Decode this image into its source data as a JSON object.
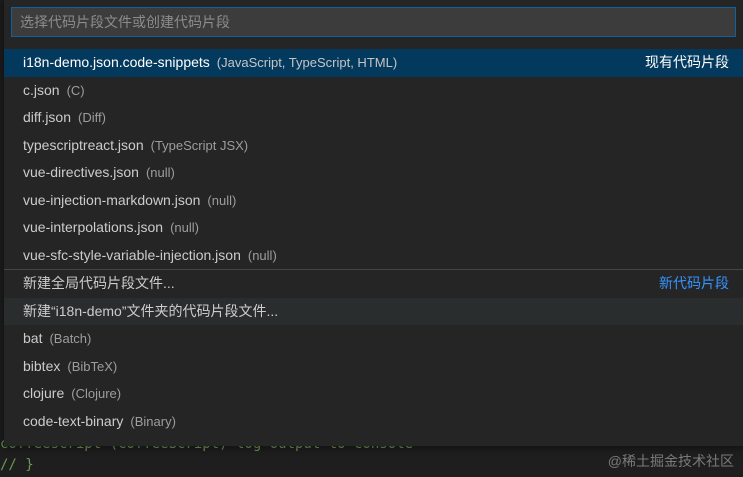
{
  "search": {
    "placeholder": "选择代码片段文件或创建代码片段"
  },
  "existing_snippets": {
    "group_label": "现有代码片段",
    "items": [
      {
        "name": "i18n-demo.json.code-snippets",
        "desc": "(JavaScript, TypeScript, HTML)"
      },
      {
        "name": "c.json",
        "desc": "(C)"
      },
      {
        "name": "diff.json",
        "desc": "(Diff)"
      },
      {
        "name": "typescriptreact.json",
        "desc": "(TypeScript JSX)"
      },
      {
        "name": "vue-directives.json",
        "desc": "(null)"
      },
      {
        "name": "vue-injection-markdown.json",
        "desc": "(null)"
      },
      {
        "name": "vue-interpolations.json",
        "desc": "(null)"
      },
      {
        "name": "vue-sfc-style-variable-injection.json",
        "desc": "(null)"
      }
    ]
  },
  "new_snippets": {
    "group_label": "新代码片段",
    "global_label": "新建全局代码片段文件...",
    "folder_label": "新建“i18n-demo”文件夹的代码片段文件...",
    "languages": [
      {
        "name": "bat",
        "desc": "(Batch)"
      },
      {
        "name": "bibtex",
        "desc": "(BibTeX)"
      },
      {
        "name": "clojure",
        "desc": "(Clojure)"
      },
      {
        "name": "code-text-binary",
        "desc": "(Binary)"
      }
    ]
  },
  "editor_background": {
    "line1": "  coffeescript (CoffeeScript)  log output to console",
    "line2": "// }"
  },
  "watermark": "@稀土掘金技术社区"
}
